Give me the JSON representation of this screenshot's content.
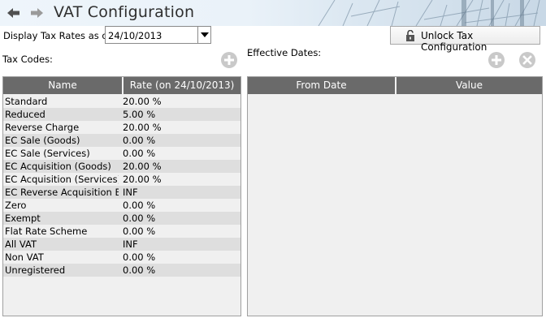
{
  "window": {
    "title": "VAT Configuration"
  },
  "toolbar": {
    "display_label": "Display Tax Rates as of:",
    "date_value": "24/10/2013",
    "unlock_label": "Unlock Tax Configuration"
  },
  "tax_codes": {
    "label": "Tax Codes:",
    "columns": [
      "Name",
      "Rate (on 24/10/2013)"
    ],
    "rows": [
      {
        "name": "Standard",
        "rate": "20.00 %"
      },
      {
        "name": "Reduced",
        "rate": "5.00 %"
      },
      {
        "name": "Reverse Charge",
        "rate": "20.00 %"
      },
      {
        "name": "EC Sale (Goods)",
        "rate": "0.00 %"
      },
      {
        "name": "EC Sale (Services)",
        "rate": "0.00 %"
      },
      {
        "name": "EC Acquisition (Goods)",
        "rate": "20.00 %"
      },
      {
        "name": "EC Acquisition (Services)",
        "rate": "20.00 %"
      },
      {
        "name": "EC Reverse Acquisition B...",
        "rate": "INF"
      },
      {
        "name": "Zero",
        "rate": "0.00 %"
      },
      {
        "name": "Exempt",
        "rate": "0.00 %"
      },
      {
        "name": "Flat Rate Scheme",
        "rate": "0.00 %"
      },
      {
        "name": "All VAT",
        "rate": "INF"
      },
      {
        "name": "Non VAT",
        "rate": "0.00 %"
      },
      {
        "name": "Unregistered",
        "rate": "0.00 %"
      }
    ]
  },
  "effective_dates": {
    "label": "Effective Dates:",
    "columns": [
      "From Date",
      "Value"
    ]
  },
  "icons": {
    "back": "arrow-left-icon",
    "forward": "arrow-right-icon",
    "unlock": "padlock-open-icon",
    "add": "plus-circle-icon",
    "remove": "x-circle-icon"
  },
  "colors": {
    "header_gray": "#6a6a6a",
    "alt_row": "#dedede",
    "grid_bg": "#f0f0f0"
  }
}
